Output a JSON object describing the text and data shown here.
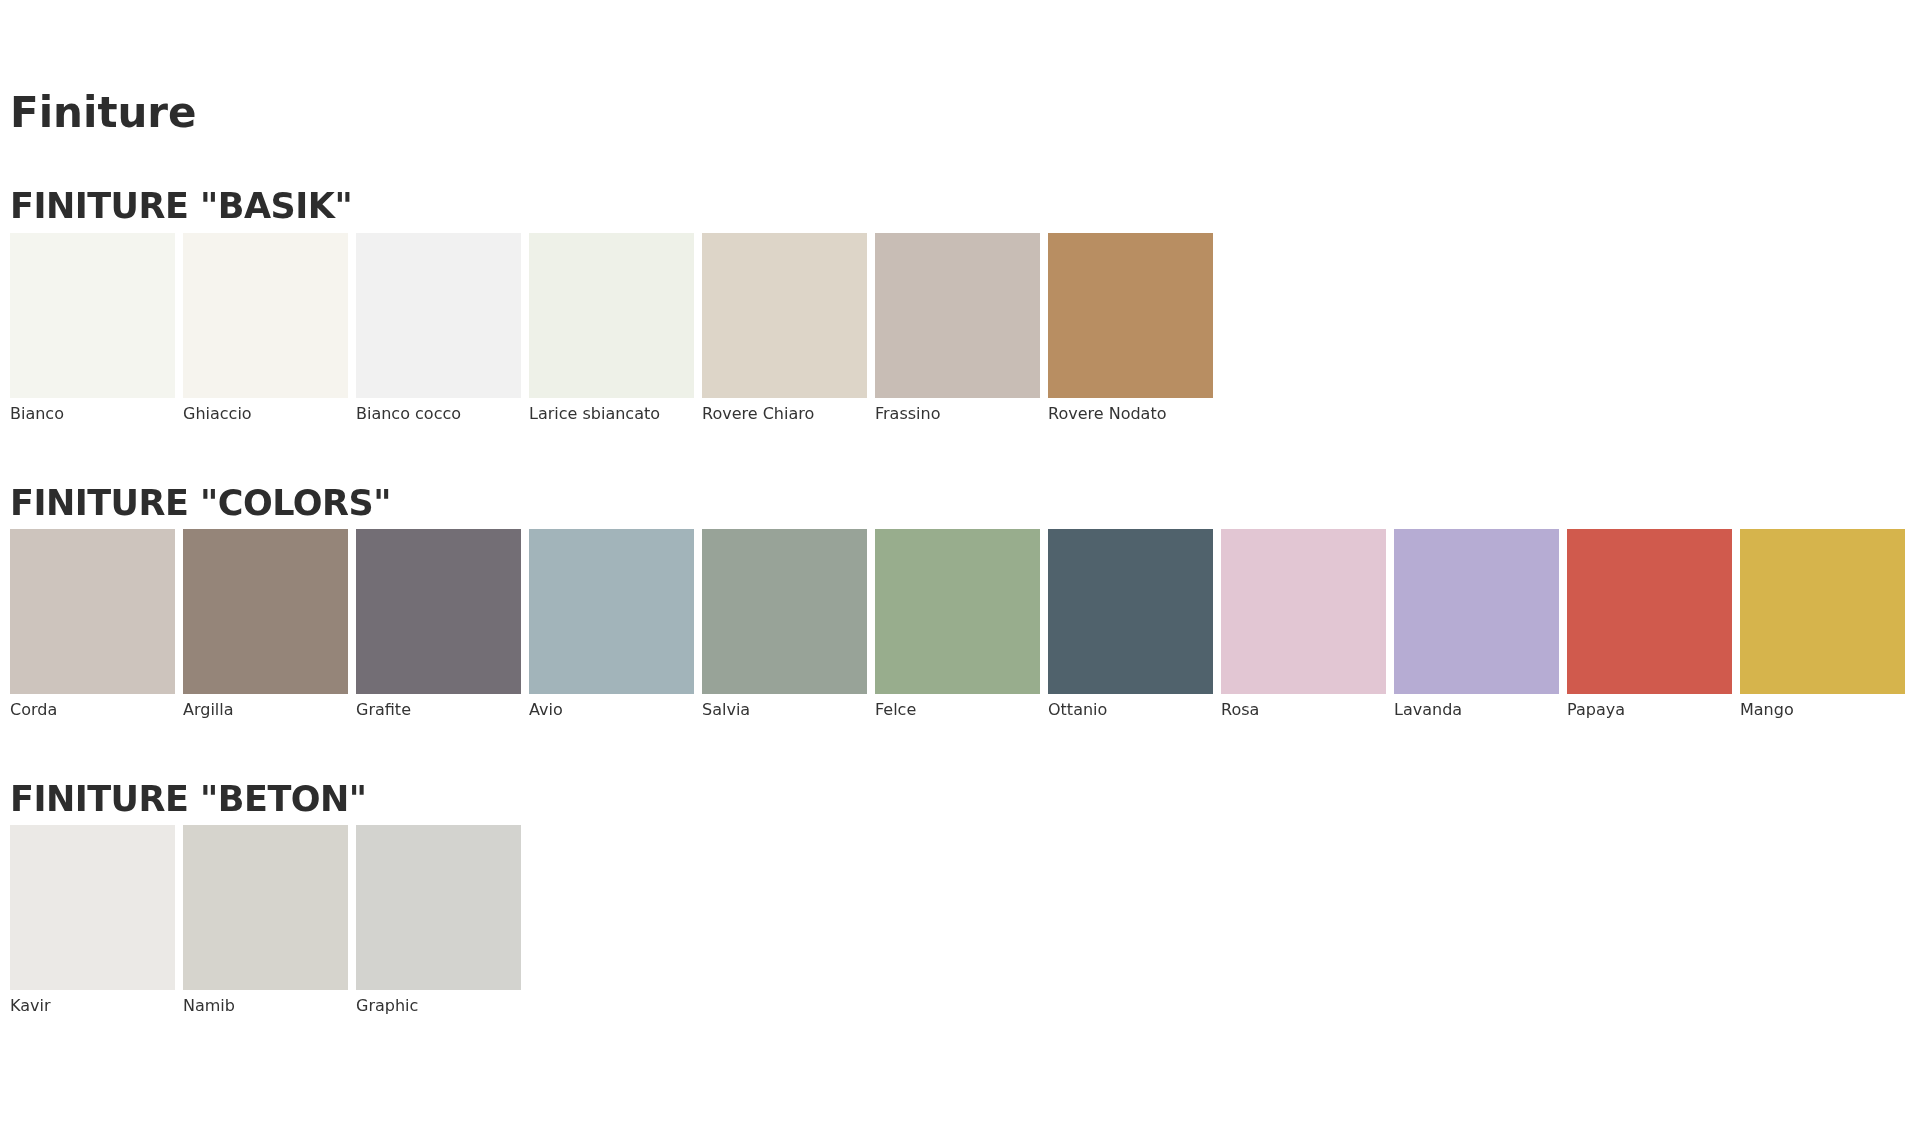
{
  "title": "Finiture",
  "groups": [
    {
      "heading": "FINITURE \"BASIK\"",
      "items": [
        {
          "name": "Bianco",
          "color": "#f4f5ef"
        },
        {
          "name": "Ghiaccio",
          "color": "#f6f4ee"
        },
        {
          "name": "Bianco cocco",
          "color": "#f1f1f1"
        },
        {
          "name": "Larice sbiancato",
          "color": "#eef1e8"
        },
        {
          "name": "Rovere Chiaro",
          "color": "#ddd5c8"
        },
        {
          "name": "Frassino",
          "color": "#c8bdb5"
        },
        {
          "name": "Rovere Nodato",
          "color": "#b88e62"
        }
      ]
    },
    {
      "heading": "FINITURE \"COLORS\"",
      "items": [
        {
          "name": "Corda",
          "color": "#cdc4bd"
        },
        {
          "name": "Argilla",
          "color": "#958579"
        },
        {
          "name": "Grafite",
          "color": "#736e75"
        },
        {
          "name": "Avio",
          "color": "#a2b4ba"
        },
        {
          "name": "Salvia",
          "color": "#98a398"
        },
        {
          "name": "Felce",
          "color": "#98ad8d"
        },
        {
          "name": "Ottanio",
          "color": "#50626c"
        },
        {
          "name": "Rosa",
          "color": "#e2c6d3"
        },
        {
          "name": "Lavanda",
          "color": "#b6acd3"
        },
        {
          "name": "Papaya",
          "color": "#d05a4d"
        },
        {
          "name": "Mango",
          "color": "#d6b44c"
        }
      ]
    },
    {
      "heading": "FINITURE \"BETON\"",
      "items": [
        {
          "name": "Kavir",
          "color": "#ebe9e6"
        },
        {
          "name": "Namib",
          "color": "#d6d4cd"
        },
        {
          "name": "Graphic",
          "color": "#d3d3cf"
        }
      ]
    }
  ]
}
